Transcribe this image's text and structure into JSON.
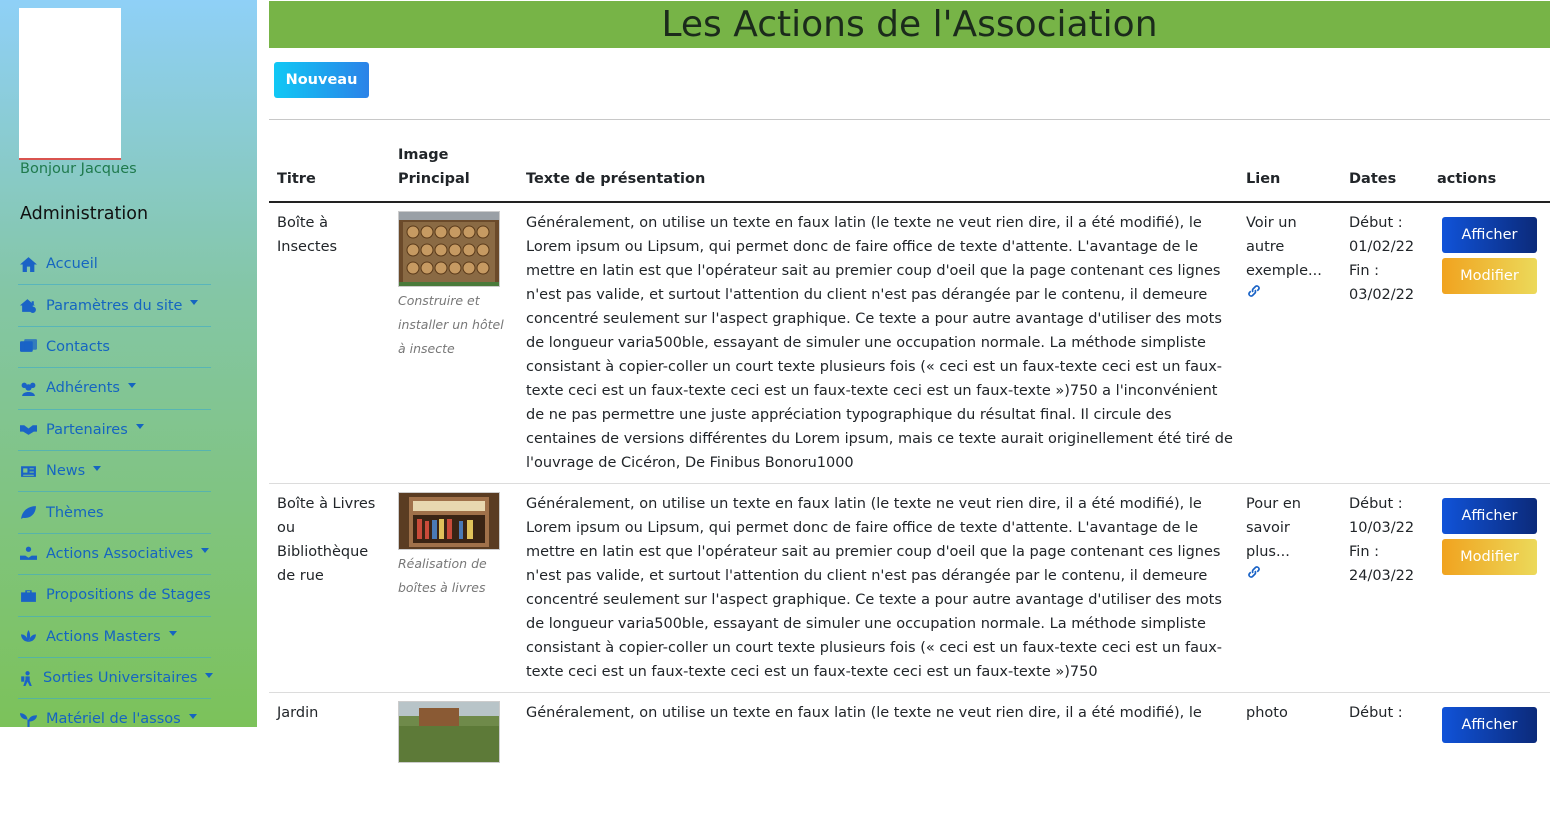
{
  "sidebar": {
    "greeting": "Bonjour Jacques",
    "section": "Administration",
    "items": [
      {
        "label": "Accueil",
        "icon": "home-icon",
        "dropdown": false
      },
      {
        "label": "Paramètres du site",
        "icon": "settings-icon",
        "dropdown": true
      },
      {
        "label": "Contacts",
        "icon": "contacts-icon",
        "dropdown": false
      },
      {
        "label": "Adhérents",
        "icon": "users-icon",
        "dropdown": true
      },
      {
        "label": "Partenaires",
        "icon": "handshake-icon",
        "dropdown": true
      },
      {
        "label": "News",
        "icon": "newspaper-icon",
        "dropdown": true
      },
      {
        "label": "Thèmes",
        "icon": "leaf-icon",
        "dropdown": false
      },
      {
        "label": "Actions Associatives",
        "icon": "hand-holding-icon",
        "dropdown": true
      },
      {
        "label": "Propositions de Stages",
        "icon": "briefcase-icon",
        "dropdown": false
      },
      {
        "label": "Actions Masters",
        "icon": "lotus-icon",
        "dropdown": true
      },
      {
        "label": "Sorties Universitaires",
        "icon": "hiking-icon",
        "dropdown": true
      },
      {
        "label": "Matériel de l'assos",
        "icon": "seedling-icon",
        "dropdown": true
      }
    ]
  },
  "header": {
    "title": "Les Actions de l'Association"
  },
  "toolbar": {
    "new_label": "Nouveau"
  },
  "table": {
    "headers": {
      "title": "Titre",
      "image": "Image\nPrincipal",
      "text": "Texte de présentation",
      "link": "Lien",
      "dates": "Dates",
      "actions": "actions"
    },
    "show_label": "Afficher",
    "edit_label": "Modifier",
    "rows": [
      {
        "title": "Boîte à Insectes",
        "caption": "Construire et installer un hôtel à insecte",
        "text": "Généralement, on utilise un texte en faux latin (le texte ne veut rien dire, il a été modifié), le Lorem ipsum ou Lipsum, qui permet donc de faire office de texte d'attente. L'avantage de le mettre en latin est que l'opérateur sait au premier coup d'oeil que la page contenant ces lignes n'est pas valide, et surtout l'attention du client n'est pas dérangée par le contenu, il demeure concentré seulement sur l'aspect graphique. Ce texte a pour autre avantage d'utiliser des mots de longueur varia500ble, essayant de simuler une occupation normale. La méthode simpliste consistant à copier-coller un court texte plusieurs fois (« ceci est un faux-texte ceci est un faux-texte ceci est un faux-texte ceci est un faux-texte ceci est un faux-texte »)750 a l'inconvénient de ne pas permettre une juste appréciation typographique du résultat final. Il circule des centaines de versions différentes du Lorem ipsum, mais ce texte aurait originellement été tiré de l'ouvrage de Cicéron, De Finibus Bonoru1000",
        "link": "Voir un autre exemple...",
        "date_start": "Début : 01/02/22",
        "date_end": "Fin : 03/02/22"
      },
      {
        "title": "Boîte à Livres ou Bibliothèque de rue",
        "caption": "Réalisation de boîtes à livres",
        "text": "Généralement, on utilise un texte en faux latin (le texte ne veut rien dire, il a été modifié), le Lorem ipsum ou Lipsum, qui permet donc de faire office de texte d'attente. L'avantage de le mettre en latin est que l'opérateur sait au premier coup d'oeil que la page contenant ces lignes n'est pas valide, et surtout l'attention du client n'est pas dérangée par le contenu, il demeure concentré seulement sur l'aspect graphique. Ce texte a pour autre avantage d'utiliser des mots de longueur varia500ble, essayant de simuler une occupation normale. La méthode simpliste consistant à copier-coller un court texte plusieurs fois (« ceci est un faux-texte ceci est un faux-texte ceci est un faux-texte ceci est un faux-texte ceci est un faux-texte »)750",
        "link": "Pour en savoir plus...",
        "date_start": "Début : 10/03/22",
        "date_end": "Fin : 24/03/22"
      },
      {
        "title": "Jardin",
        "caption": "",
        "text": "Généralement, on utilise un texte en faux latin (le texte ne veut rien dire, il a été modifié), le",
        "link": "photo",
        "date_start": "Début :",
        "date_end": ""
      }
    ]
  },
  "colors": {
    "header_bg": "#77b447",
    "show_btn": "#1053d9",
    "edit_btn": "#f0a31f",
    "link": "#1a63c6"
  }
}
